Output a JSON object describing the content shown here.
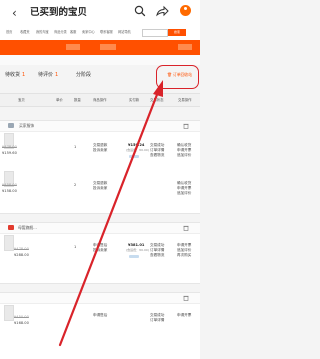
{
  "header": {
    "back_icon": "‹",
    "title": "已买到的宝贝",
    "icons": [
      "search-icon",
      "share-icon",
      "more-icon"
    ],
    "badge_color": "#ff6a00"
  },
  "nav": {
    "items": [
      "首页",
      "收藏夹",
      "我的淘宝",
      "商品分类",
      "客服",
      "卖家中心",
      "联系客服",
      "网站导航"
    ],
    "search_button": "搜索"
  },
  "tabs": [
    {
      "label": "待收货",
      "count": "1"
    },
    {
      "label": "待评价",
      "count": "1"
    },
    {
      "label": "分阶段",
      "count": ""
    }
  ],
  "recycle_label": "订单回收站",
  "table_headers": [
    "宝贝",
    "单价",
    "数量",
    "商品操作",
    "实付款",
    "交易状态",
    "交易操作"
  ],
  "orders": [
    {
      "shop": "买家服饰",
      "items": [
        {
          "orig_price": "¥478.00",
          "price": "¥159.60",
          "qty": "1",
          "action": "交易退款\n投诉卖家",
          "paid": "¥159.24",
          "paid_note": "(含运费：¥0.00)",
          "status": "交易成功\n订单详情\n查看物流",
          "ops": "确认收货\n申请开票\n追加评价"
        },
        {
          "orig_price": "¥458.00",
          "price": "¥158.00",
          "qty": "2",
          "action": "交易退款\n投诉卖家",
          "paid": "",
          "paid_note": "",
          "status": "",
          "ops": "确认收货\n申请开票\n追加评价"
        }
      ]
    },
    {
      "shop": "母婴旗舰...",
      "items": [
        {
          "orig_price": "¥478.00",
          "price": "¥288.00",
          "qty": "1",
          "action": "申请售后\n投诉卖家",
          "paid": "¥381.01",
          "paid_note": "(含运费：¥0.00)",
          "status": "交易成功\n订单详情\n查看物流",
          "ops": "申请开票\n追加评价\n再次购买"
        }
      ]
    },
    {
      "shop": "",
      "items": [
        {
          "orig_price": "¥450.00",
          "price": "¥168.00",
          "qty": "",
          "action": "申请售后",
          "paid": "",
          "paid_note": "",
          "status": "交易成功\n订单详情",
          "ops": "申请开票"
        }
      ]
    }
  ],
  "annotation_color": "#d9232a"
}
